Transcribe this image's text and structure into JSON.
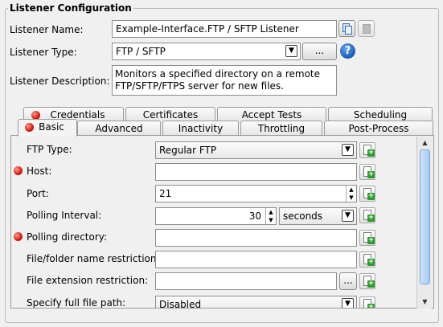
{
  "group": {
    "title": "Listener Configuration"
  },
  "listener": {
    "name_label": "Listener Name:",
    "name_value": "Example-Interface.FTP / SFTP Listener",
    "type_label": "Listener Type:",
    "type_value": "FTP / SFTP",
    "type_button": "...",
    "help": "?",
    "desc_label": "Listener Description:",
    "desc_line1": "Monitors a specified directory on a remote",
    "desc_line2": "FTP/SFTP/FTPS server for new files."
  },
  "tabs_back": [
    "Credentials",
    "Certificates",
    "Accept Tests",
    "Scheduling"
  ],
  "tabs_front": [
    "Basic",
    "Advanced",
    "Inactivity",
    "Throttling",
    "Post-Process"
  ],
  "form": {
    "ftp_type_label": "FTP Type:",
    "ftp_type_value": "Regular FTP",
    "host_label": "Host:",
    "host_value": "",
    "port_label": "Port:",
    "port_value": "21",
    "poll_interval_label": "Polling Interval:",
    "poll_interval_value": "30",
    "poll_interval_unit": "seconds",
    "poll_dir_label": "Polling directory:",
    "poll_dir_value": "",
    "name_restr_label": "File/folder name restriction:",
    "name_restr_value": "",
    "ext_restr_label": "File extension restriction:",
    "ext_restr_value": "",
    "ext_button": "...",
    "full_path_label": "Specify full file path:",
    "full_path_value": "Disabled"
  },
  "colors": {
    "required_dot": "#d21a0a",
    "add_icon": "#2e9b2e",
    "help_icon": "#1e5fb8"
  }
}
